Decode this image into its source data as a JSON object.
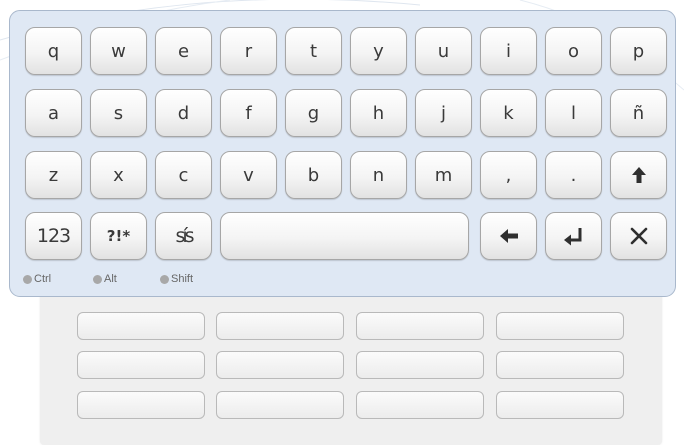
{
  "keyboard": {
    "row1": [
      "q",
      "w",
      "e",
      "r",
      "t",
      "y",
      "u",
      "i",
      "o",
      "p"
    ],
    "row2": [
      "a",
      "s",
      "d",
      "f",
      "g",
      "h",
      "j",
      "k",
      "l",
      "ñ"
    ],
    "row3": [
      "z",
      "x",
      "c",
      "v",
      "b",
      "n",
      "m",
      ",",
      "."
    ],
    "numbers_label": "123",
    "symbols_label": "?!*",
    "accent_label": "sís"
  },
  "modifiers": {
    "ctrl": "Ctrl",
    "alt": "Alt",
    "shift": "Shift"
  },
  "icons": {
    "shift": "up-arrow-icon",
    "backspace": "left-arrow-icon",
    "enter": "enter-icon",
    "close": "close-icon"
  },
  "colors": {
    "keyboard_bg": "#dfe8f4",
    "key_text": "#3a3a3a",
    "indicator_off": "#a8a8a8"
  }
}
